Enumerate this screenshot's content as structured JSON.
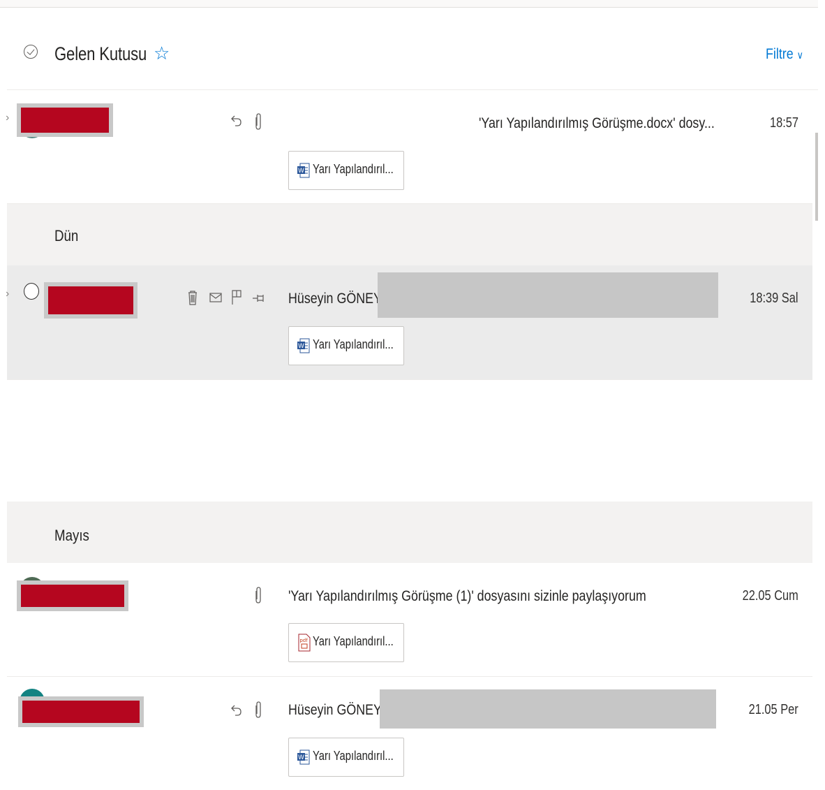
{
  "header": {
    "title": "Gelen Kutusu",
    "filter_label": "Filtre"
  },
  "colors": {
    "accent": "#0078d4",
    "redaction": "#b5061f",
    "hover_row": "#ebebeb",
    "section_bg": "#f3f2f1"
  },
  "sections": {
    "yesterday": "Dün",
    "may": "Mayıs"
  },
  "messages": [
    {
      "subject": "'Yarı Yapılandırılmış Görüşme.docx' dosy...",
      "time": "18:57",
      "attachment": "Yarı Yapılandırıl...",
      "attachment_type": "word",
      "icons": [
        "reply-icon",
        "paperclip-icon"
      ]
    },
    {
      "sender": "Hüseyin GÖNEY",
      "time": "18:39 Sal",
      "attachment": "Yarı Yapılandırıl...",
      "attachment_type": "word",
      "icons": [
        "delete-icon",
        "mark-read-icon",
        "flag-icon",
        "pin-icon"
      ]
    },
    {
      "subject": "'Yarı Yapılandırılmış Görüşme (1)' dosyasını sizinle paylaşıyorum",
      "time": "22.05 Cum",
      "attachment": "Yarı Yapılandırıl...",
      "attachment_type": "pdf",
      "icons": [
        "paperclip-icon"
      ]
    },
    {
      "sender": "Hüseyin GÖNEY",
      "time": "21.05 Per",
      "attachment": "Yarı Yapılandırıl...",
      "attachment_type": "word",
      "icons": [
        "reply-icon",
        "paperclip-icon"
      ]
    }
  ]
}
